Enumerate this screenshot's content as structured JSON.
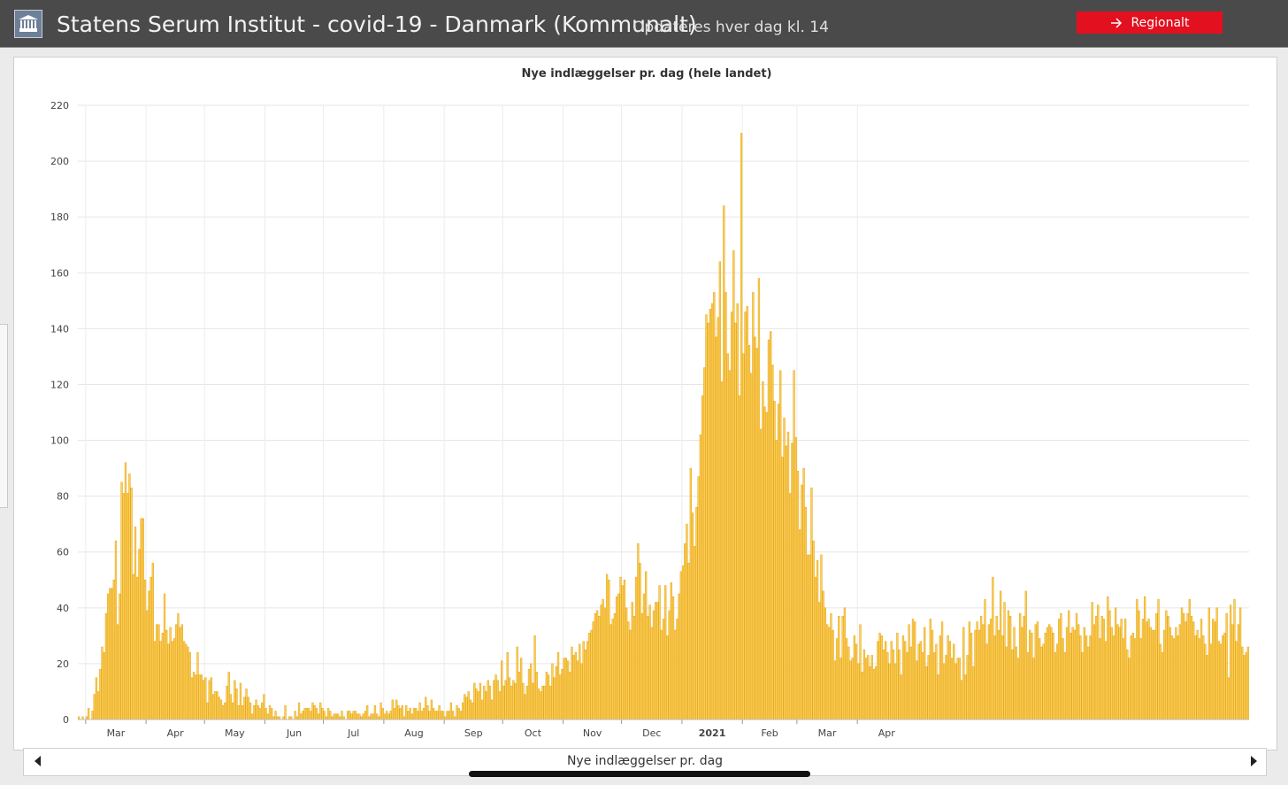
{
  "header": {
    "title": "Statens Serum Institut - covid-19 - Danmark (Kommunalt)",
    "subtitle": "Opdateres hver dag kl. 14",
    "regional_button": "Regionalt"
  },
  "footer": {
    "label": "Nye indlæggelser pr. dag"
  },
  "colors": {
    "bar_fill": "#fdcf55",
    "bar_stroke": "#e3a41b",
    "accent": "#e3101f",
    "header_bg": "#4a4a4a"
  },
  "icons": {
    "logo": "institute-building-icon",
    "button": "arrow-right-icon",
    "nav_prev": "triangle-left-icon",
    "nav_next": "triangle-right-icon"
  },
  "chart_data": {
    "type": "bar",
    "title": "Nye indlæggelser pr. dag (hele landet)",
    "xlabel": "",
    "ylabel": "",
    "ylim": [
      0,
      220
    ],
    "yticks": [
      0,
      20,
      40,
      60,
      80,
      100,
      120,
      140,
      160,
      180,
      200,
      220
    ],
    "grid": true,
    "x_start": "2020-02-26",
    "x_ticks": [
      {
        "label": "Mar",
        "date": "2020-03-01"
      },
      {
        "label": "Apr",
        "date": "2020-04-01"
      },
      {
        "label": "May",
        "date": "2020-05-01"
      },
      {
        "label": "Jun",
        "date": "2020-06-01"
      },
      {
        "label": "Jul",
        "date": "2020-07-01"
      },
      {
        "label": "Aug",
        "date": "2020-08-01"
      },
      {
        "label": "Sep",
        "date": "2020-09-01"
      },
      {
        "label": "Oct",
        "date": "2020-10-01"
      },
      {
        "label": "Nov",
        "date": "2020-11-01"
      },
      {
        "label": "Dec",
        "date": "2020-12-01"
      },
      {
        "label": "2021",
        "date": "2021-01-01",
        "bold": true
      },
      {
        "label": "Feb",
        "date": "2021-02-01"
      },
      {
        "label": "Mar",
        "date": "2021-03-01"
      },
      {
        "label": "Apr",
        "date": "2021-04-01"
      }
    ],
    "values": [
      1,
      0,
      1,
      0,
      1,
      4,
      0,
      3,
      9,
      15,
      10,
      18,
      26,
      24,
      38,
      45,
      47,
      47,
      50,
      64,
      34,
      45,
      85,
      81,
      92,
      81,
      88,
      83,
      52,
      69,
      51,
      61,
      72,
      72,
      50,
      39,
      46,
      51,
      56,
      28,
      34,
      34,
      28,
      31,
      45,
      32,
      27,
      33,
      28,
      29,
      34,
      38,
      33,
      34,
      28,
      27,
      26,
      24,
      15,
      17,
      16,
      24,
      16,
      16,
      14,
      15,
      6,
      14,
      15,
      9,
      10,
      10,
      8,
      7,
      5,
      6,
      12,
      17,
      9,
      6,
      14,
      11,
      5,
      13,
      5,
      8,
      11,
      8,
      6,
      2,
      5,
      7,
      5,
      4,
      6,
      9,
      4,
      2,
      5,
      4,
      1,
      3,
      1,
      1,
      0,
      1,
      5,
      0,
      1,
      1,
      0,
      3,
      1,
      6,
      2,
      3,
      4,
      4,
      4,
      3,
      6,
      5,
      4,
      2,
      6,
      4,
      3,
      1,
      4,
      3,
      1,
      2,
      2,
      2,
      1,
      3,
      1,
      0,
      3,
      3,
      2,
      3,
      3,
      2,
      2,
      1,
      2,
      3,
      5,
      1,
      2,
      2,
      5,
      2,
      1,
      6,
      4,
      2,
      3,
      2,
      3,
      7,
      4,
      7,
      5,
      4,
      5,
      1,
      5,
      3,
      4,
      2,
      4,
      4,
      3,
      6,
      3,
      4,
      8,
      5,
      3,
      7,
      4,
      3,
      3,
      5,
      3,
      3,
      1,
      3,
      3,
      6,
      3,
      1,
      5,
      4,
      3,
      6,
      9,
      8,
      10,
      7,
      6,
      13,
      11,
      10,
      13,
      7,
      12,
      10,
      14,
      12,
      7,
      14,
      16,
      14,
      10,
      21,
      12,
      14,
      24,
      15,
      12,
      14,
      13,
      26,
      17,
      22,
      13,
      9,
      12,
      18,
      20,
      13,
      30,
      17,
      11,
      10,
      12,
      12,
      17,
      16,
      12,
      20,
      15,
      19,
      24,
      16,
      18,
      22,
      22,
      21,
      17,
      26,
      23,
      24,
      21,
      27,
      20,
      28,
      25,
      28,
      31,
      32,
      35,
      38,
      39,
      37,
      41,
      43,
      40,
      52,
      50,
      34,
      36,
      38,
      44,
      45,
      51,
      48,
      50,
      40,
      35,
      32,
      42,
      37,
      51,
      63,
      56,
      38,
      45,
      53,
      37,
      41,
      33,
      39,
      42,
      42,
      48,
      32,
      36,
      48,
      30,
      39,
      49,
      44,
      32,
      36,
      45,
      53,
      55,
      63,
      70,
      56,
      90,
      74,
      62,
      76,
      87,
      102,
      116,
      126,
      145,
      142,
      147,
      149,
      153,
      137,
      144,
      164,
      121,
      184,
      153,
      131,
      125,
      146,
      168,
      142,
      149,
      116,
      210,
      131,
      146,
      148,
      134,
      124,
      153,
      137,
      133,
      158,
      104,
      121,
      112,
      110,
      136,
      139,
      127,
      114,
      100,
      113,
      125,
      94,
      108,
      98,
      103,
      81,
      99,
      125,
      101,
      89,
      68,
      84,
      90,
      76,
      59,
      59,
      83,
      64,
      51,
      57,
      42,
      59,
      46,
      40,
      34,
      33,
      38,
      32,
      21,
      29,
      37,
      22,
      37,
      40,
      29,
      26,
      21,
      22,
      30,
      27,
      20,
      34,
      17,
      25,
      22,
      23,
      19,
      23,
      18,
      19,
      28,
      31,
      30,
      25,
      28,
      24,
      20,
      28,
      25,
      20,
      31,
      25,
      16,
      30,
      28,
      24,
      34,
      26,
      36,
      35,
      21,
      27,
      28,
      24,
      33,
      19,
      23,
      36,
      32,
      24,
      27,
      16,
      30,
      35,
      20,
      23,
      30,
      28,
      22,
      27,
      20,
      22,
      22,
      14,
      33,
      16,
      23,
      35,
      31,
      19,
      32,
      35,
      32,
      37,
      34,
      43,
      27,
      34,
      36,
      51,
      30,
      37,
      32,
      46,
      30,
      42,
      26,
      39,
      37,
      25,
      33,
      26,
      22,
      38,
      33,
      37,
      46,
      24,
      32,
      31,
      22,
      34,
      35,
      29,
      26,
      27,
      31,
      33,
      34,
      33,
      31,
      24,
      27,
      36,
      38,
      29,
      24,
      33,
      39,
      31,
      33,
      32,
      38,
      34,
      30,
      24,
      33,
      30,
      26,
      30,
      42,
      34,
      37,
      41,
      29,
      37,
      36,
      28,
      44,
      39,
      33,
      30,
      40,
      34,
      33,
      36,
      29,
      36,
      25,
      22,
      30,
      31,
      29,
      43,
      39,
      29,
      36,
      44,
      35,
      36,
      33,
      32,
      32,
      38,
      43,
      27,
      24,
      32,
      39,
      37,
      33,
      30,
      29,
      33,
      30,
      34,
      40,
      38,
      35,
      38,
      43,
      37,
      35,
      30,
      32,
      29,
      36,
      30,
      27,
      23,
      40,
      27,
      36,
      35,
      40,
      28,
      27,
      30,
      31,
      38,
      15,
      41,
      34,
      43,
      28,
      34,
      40,
      26,
      23,
      24,
      26
    ]
  }
}
